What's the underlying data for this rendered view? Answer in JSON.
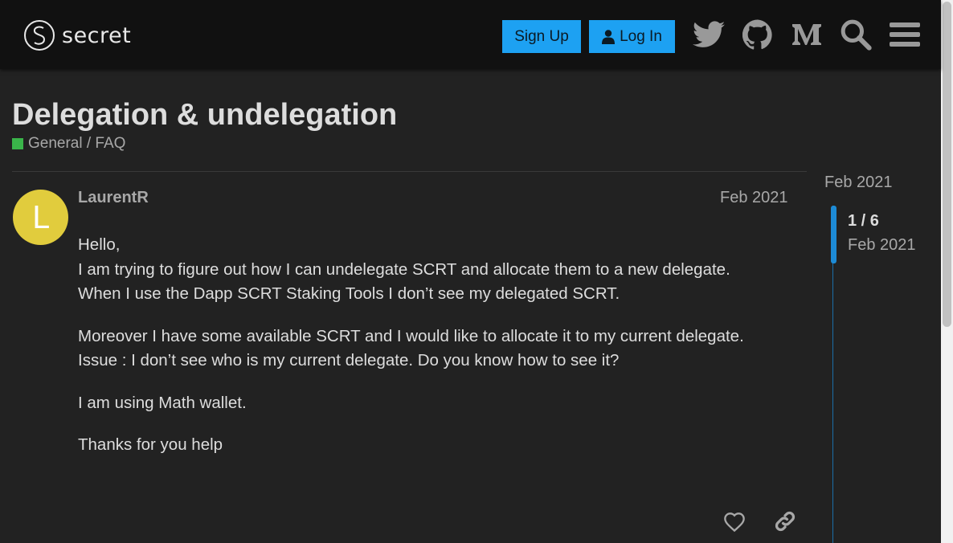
{
  "header": {
    "logo_text": "secret",
    "signup_label": "Sign Up",
    "login_label": "Log In",
    "icons": [
      "twitter-icon",
      "github-icon",
      "medium-icon",
      "search-icon",
      "menu-icon"
    ]
  },
  "topic": {
    "title": "Delegation & undelegation",
    "category": "General / FAQ",
    "category_color": "#3ab54a"
  },
  "post": {
    "avatar_letter": "L",
    "avatar_color": "#e1cc3d",
    "username": "LaurentR",
    "date": "Feb 2021",
    "paragraphs": [
      "Hello,\nI am trying to figure out how I can undelegate SCRT and allocate them to a new delegate.\nWhen I use the Dapp SCRT Staking Tools I don’t see my delegated SCRT.",
      "Moreover I have some available SCRT and I would like to allocate it to my current delegate.\nIssue : I don’t see who is my current delegate. Do you know how to see it?",
      "I am using Math wallet.",
      "Thanks for you help"
    ]
  },
  "timeline": {
    "start_date": "Feb 2021",
    "position": "1 / 6",
    "current_date": "Feb 2021"
  }
}
